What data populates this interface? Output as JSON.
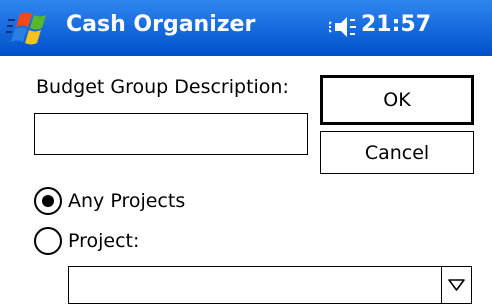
{
  "titlebar": {
    "app_title": "Cash Organizer",
    "clock": "21:57",
    "icons": {
      "start": "windows-flag-icon",
      "volume": "speaker-icon"
    },
    "colors": {
      "bar_top": "#2f86f0",
      "bar_bottom": "#0050c9",
      "text": "#ffffff"
    }
  },
  "form": {
    "description_label": "Budget Group Description:",
    "description_value": "",
    "ok_label": "OK",
    "cancel_label": "Cancel",
    "radio_any_label": "Any Projects",
    "radio_any_checked": true,
    "radio_project_label": "Project:",
    "radio_project_checked": false,
    "project_selected": "",
    "project_arrow_icon": "dropdown-arrow-icon"
  }
}
